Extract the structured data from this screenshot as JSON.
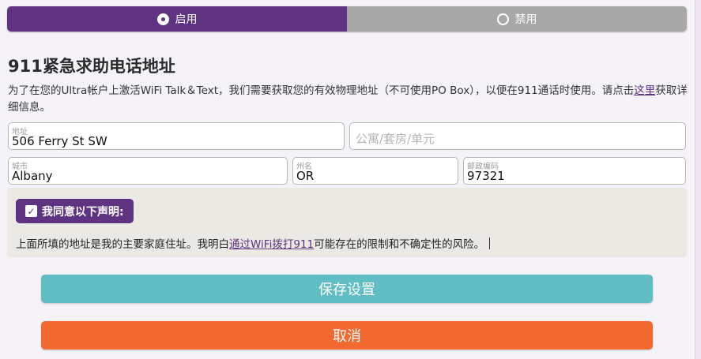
{
  "toggle": {
    "enabled_label": "启用",
    "disabled_label": "禁用",
    "selected": "enabled"
  },
  "title": "911紧急求助电话地址",
  "description": {
    "text": "为了在您的Ultra帐户上激活WiFi Talk＆Text，我们需要获取您的有效物理地址（不可使用PO Box），以便在911通话时使用。请点击",
    "link": "这里",
    "suffix": "获取详细信息。"
  },
  "form": {
    "address": {
      "label": "地址",
      "value": "506 Ferry St SW"
    },
    "unit": {
      "placeholder": "公寓/套房/单元",
      "value": ""
    },
    "city": {
      "label": "城市",
      "value": "Albany"
    },
    "state": {
      "label": "州名",
      "value": "OR"
    },
    "zip": {
      "label": "邮政编码",
      "value": "97321"
    }
  },
  "agreement": {
    "checkbox_label": "我同意以下声明:",
    "checked": true,
    "statement_prefix": "上面所填的地址是我的主要家庭住址。我明白",
    "statement_link": "通过WiFi拨打911",
    "statement_suffix": "可能存在的限制和不确定性的风险。"
  },
  "buttons": {
    "save": "保存设置",
    "cancel": "取消"
  },
  "colors": {
    "brand_purple": "#5e3382",
    "toggle_off": "#a8a8a8",
    "save": "#60bdc4",
    "cancel": "#f26a30"
  }
}
